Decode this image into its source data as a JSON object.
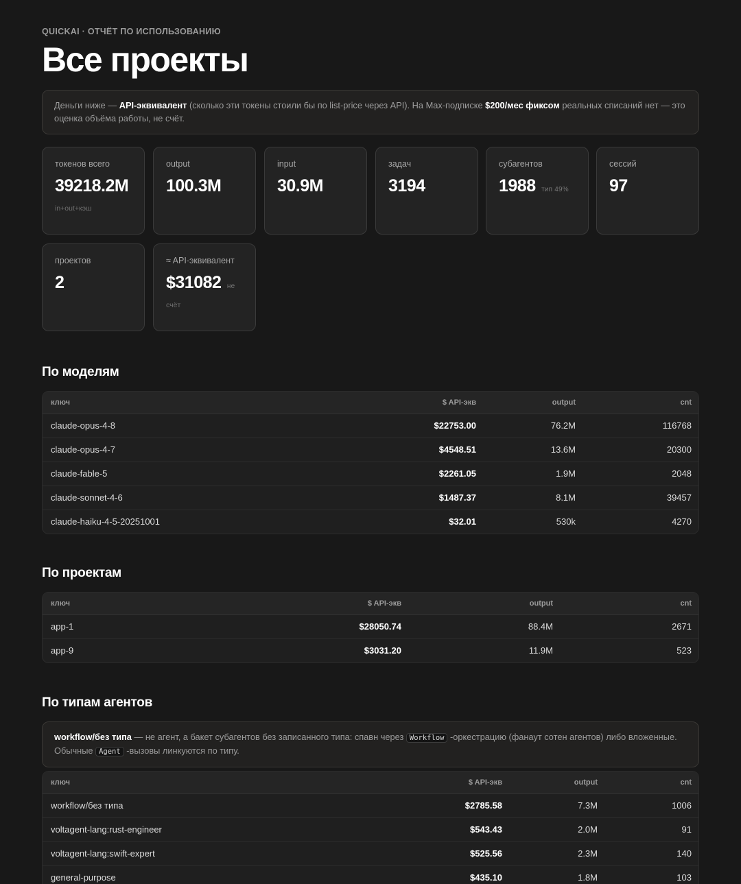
{
  "header": {
    "eyebrow": "QUICKAI · ОТЧЁТ ПО ИСПОЛЬЗОВАНИЮ",
    "title": "Все проекты"
  },
  "notice": {
    "t1": "Деньги ниже — ",
    "b1": "API-эквивалент",
    "t2": " (сколько эти токены стоили бы по list-price через API). На Max-подписке ",
    "b2": "$200/мес фиксом",
    "t3": " реальных списаний нет — это оценка объёма работы, не счёт."
  },
  "stats": [
    {
      "label": "токенов всего",
      "value": "39218.2M",
      "suffix": "",
      "sub": "in+out+кэш"
    },
    {
      "label": "output",
      "value": "100.3M",
      "suffix": "",
      "sub": ""
    },
    {
      "label": "input",
      "value": "30.9M",
      "suffix": "",
      "sub": ""
    },
    {
      "label": "задач",
      "value": "3194",
      "suffix": "",
      "sub": ""
    },
    {
      "label": "субагентов",
      "value": "1988",
      "suffix": "тип 49%",
      "sub": ""
    },
    {
      "label": "сессий",
      "value": "97",
      "suffix": "",
      "sub": ""
    },
    {
      "label": "проектов",
      "value": "2",
      "suffix": "",
      "sub": ""
    },
    {
      "label": "≈ API-эквивалент",
      "value": "$31082",
      "suffix": "не",
      "sub": "счёт"
    }
  ],
  "columns": {
    "key": "ключ",
    "cost": "$ API-экв",
    "output": "output",
    "cnt": "cnt"
  },
  "models": {
    "title": "По моделям",
    "rows": [
      {
        "key": "claude-opus-4-8",
        "cost": "$22753.00",
        "output": "76.2M",
        "cnt": "116768"
      },
      {
        "key": "claude-opus-4-7",
        "cost": "$4548.51",
        "output": "13.6M",
        "cnt": "20300"
      },
      {
        "key": "claude-fable-5",
        "cost": "$2261.05",
        "output": "1.9M",
        "cnt": "2048"
      },
      {
        "key": "claude-sonnet-4-6",
        "cost": "$1487.37",
        "output": "8.1M",
        "cnt": "39457"
      },
      {
        "key": "claude-haiku-4-5-20251001",
        "cost": "$32.01",
        "output": "530k",
        "cnt": "4270"
      }
    ]
  },
  "projects": {
    "title": "По проектам",
    "rows": [
      {
        "key": "app-1",
        "cost": "$28050.74",
        "output": "88.4M",
        "cnt": "2671"
      },
      {
        "key": "app-9",
        "cost": "$3031.20",
        "output": "11.9M",
        "cnt": "523"
      }
    ]
  },
  "agents": {
    "title": "По типам агентов",
    "note": {
      "b1": "workflow/без типа",
      "t1": " — не агент, а бакет субагентов без записанного типа: спавн через ",
      "code1": "Workflow",
      "t2": " -оркестрацию (фанаут сотен агентов) либо вложенные. Обычные ",
      "code2": "Agent",
      "t3": " -вызовы линкуются по типу."
    },
    "rows": [
      {
        "key": "workflow/без типа",
        "cost": "$2785.58",
        "output": "7.3M",
        "cnt": "1006"
      },
      {
        "key": "voltagent-lang:rust-engineer",
        "cost": "$543.43",
        "output": "2.0M",
        "cnt": "91"
      },
      {
        "key": "voltagent-lang:swift-expert",
        "cost": "$525.56",
        "output": "2.3M",
        "cnt": "140"
      },
      {
        "key": "general-purpose",
        "cost": "$435.10",
        "output": "1.8M",
        "cnt": "103"
      }
    ]
  }
}
